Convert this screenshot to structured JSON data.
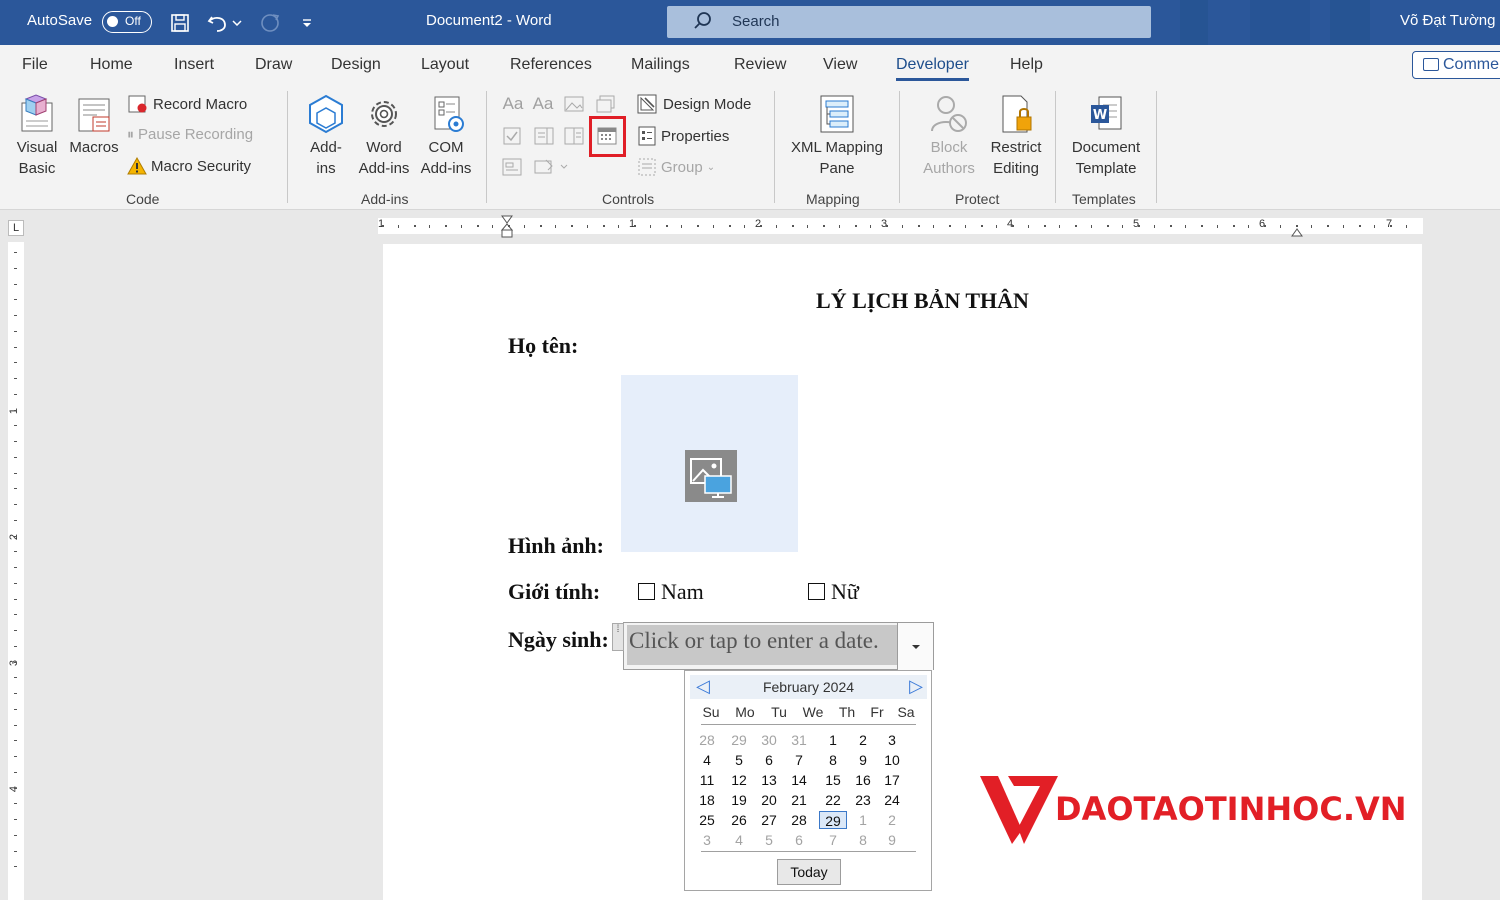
{
  "titlebar": {
    "autosave_label": "AutoSave",
    "autosave_state": "Off",
    "doc_title": "Document2  -  Word",
    "search_placeholder": "Search",
    "user_name": "Võ Đạt Tường",
    "bg_color": "#2b579a"
  },
  "tabs": [
    "File",
    "Home",
    "Insert",
    "Draw",
    "Design",
    "Layout",
    "References",
    "Mailings",
    "Review",
    "View",
    "Developer",
    "Help"
  ],
  "active_tab": "Developer",
  "comments_label": "Comme",
  "ribbon": {
    "code": {
      "visual_basic": [
        "Visual",
        "Basic"
      ],
      "macros": "Macros",
      "record_macro": "Record Macro",
      "pause_recording": "Pause Recording",
      "macro_security": "Macro Security",
      "label": "Code"
    },
    "addins": {
      "addins": [
        "Add-",
        "ins"
      ],
      "word_addins": [
        "Word",
        "Add-ins"
      ],
      "com_addins": [
        "COM",
        "Add-ins"
      ],
      "label": "Add-ins"
    },
    "controls": {
      "design_mode": "Design Mode",
      "properties": "Properties",
      "group": "Group",
      "label": "Controls"
    },
    "mapping": {
      "xml_mapping": [
        "XML Mapping",
        "Pane"
      ],
      "label": "Mapping"
    },
    "protect": {
      "block_authors": [
        "Block",
        "Authors"
      ],
      "restrict_editing": [
        "Restrict",
        "Editing"
      ],
      "label": "Protect"
    },
    "templates": {
      "document_template": [
        "Document",
        "Template"
      ],
      "label": "Templates"
    }
  },
  "ruler": {
    "h_numbers": [
      "1",
      "1",
      "2",
      "3",
      "4",
      "5",
      "6",
      "7"
    ],
    "v_numbers": [
      "1",
      "2",
      "3",
      "4"
    ]
  },
  "document": {
    "title": "LÝ LỊCH BẢN THÂN",
    "name_label": "Họ tên:",
    "photo_label": "Hình ảnh:",
    "gender_label": "Giới tính:",
    "gender_options": [
      "Nam",
      "Nữ"
    ],
    "dob_label": "Ngày sinh:",
    "date_placeholder": "Click or tap to enter a date."
  },
  "calendar": {
    "month": "February 2024",
    "weekdays": [
      "Su",
      "Mo",
      "Tu",
      "We",
      "Th",
      "Fr",
      "Sa"
    ],
    "weeks": [
      [
        "28",
        "29",
        "30",
        "31",
        "1",
        "2",
        "3"
      ],
      [
        "4",
        "5",
        "6",
        "7",
        "8",
        "9",
        "10"
      ],
      [
        "11",
        "12",
        "13",
        "14",
        "15",
        "16",
        "17"
      ],
      [
        "18",
        "19",
        "20",
        "21",
        "22",
        "23",
        "24"
      ],
      [
        "25",
        "26",
        "27",
        "28",
        "29",
        "1",
        "2"
      ],
      [
        "3",
        "4",
        "5",
        "6",
        "7",
        "8",
        "9"
      ]
    ],
    "selected": "29",
    "today_label": "Today"
  },
  "watermark": {
    "text": "DAOTAOTINHOC.VN",
    "color": "#e21f26"
  }
}
